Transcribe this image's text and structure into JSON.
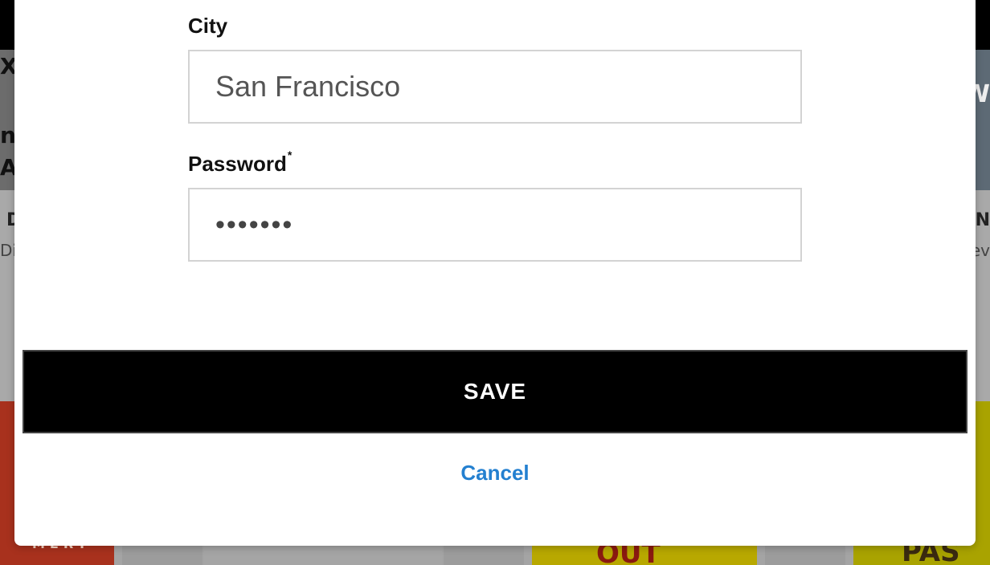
{
  "background": {
    "left_glyphs": [
      "X",
      "n",
      "A"
    ],
    "right_glyphs": [
      "W"
    ],
    "left_text": "D",
    "left_subtext": "Di",
    "right_text": "N",
    "right_subtext": "ev",
    "tile_texts": [
      "MERY",
      "OUT",
      "PAS"
    ]
  },
  "form": {
    "city_label": "City",
    "city_value": "San Francisco",
    "password_label": "Password",
    "password_required_mark": "*",
    "password_value": "•••••••"
  },
  "actions": {
    "save_label": "SAVE",
    "cancel_label": "Cancel"
  },
  "colors": {
    "save_bg": "#000000",
    "cancel_link": "#2480d0",
    "input_border": "#d3d3d3"
  }
}
